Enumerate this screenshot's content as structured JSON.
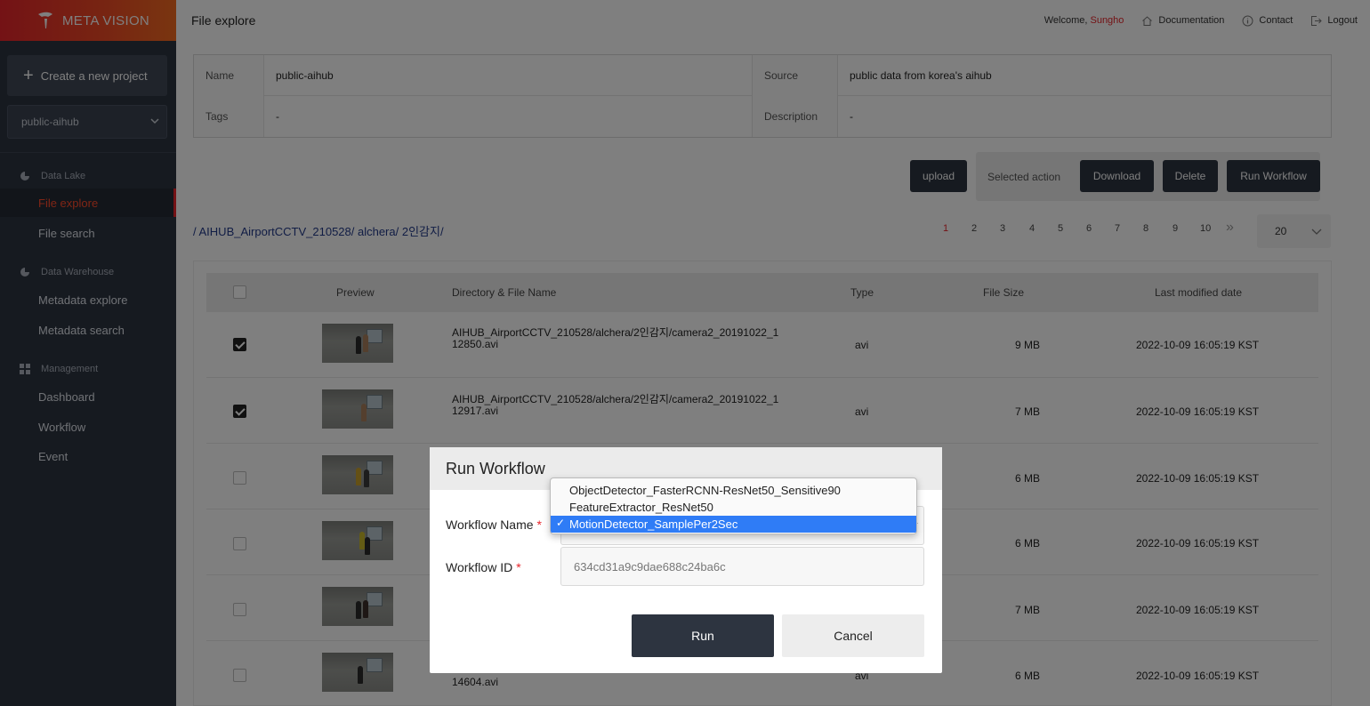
{
  "brand": {
    "name": "META VISION"
  },
  "sidebar": {
    "create_label": "Create a new project",
    "project": "public-aihub",
    "sections": [
      {
        "label": "Data Lake",
        "items": [
          "File explore",
          "File search"
        ]
      },
      {
        "label": "Data Warehouse",
        "items": [
          "Metadata explore",
          "Metadata search"
        ]
      },
      {
        "label": "Management",
        "items": [
          "Dashboard",
          "Workflow",
          "Event"
        ]
      }
    ],
    "active_item": "File explore"
  },
  "header": {
    "title": "File explore",
    "welcome": "Welcome,",
    "user": "Sungho",
    "links": [
      "Documentation",
      "Contact",
      "Logout"
    ]
  },
  "info": {
    "name_label": "Name",
    "name_value": "public-aihub",
    "source_label": "Source",
    "source_value": "public data from korea's aihub",
    "tags_label": "Tags",
    "tags_value": "-",
    "description_label": "Description",
    "description_value": "-"
  },
  "actions": {
    "upload": "upload",
    "selected_action": "Selected action",
    "download": "Download",
    "delete": "Delete",
    "run_workflow": "Run Workflow"
  },
  "path": "/ AIHUB_AirportCCTV_210528/ alchera/ 2인감지/",
  "pagination": {
    "pages": [
      "1",
      "2",
      "3",
      "4",
      "5",
      "6",
      "7",
      "8",
      "9",
      "10"
    ],
    "current": "1",
    "next": "»",
    "page_size": "20"
  },
  "table": {
    "headers": [
      "Preview",
      "Directory & File Name",
      "Type",
      "File Size",
      "Last modified date"
    ],
    "rows": [
      {
        "checked": true,
        "name_line1": "AIHUB_AirportCCTV_210528/alchera/2인감지/camera2_20191022_1",
        "name_line2": "12850.avi",
        "type": "avi",
        "size": "9 MB",
        "date": "2022-10-09 16:05:19 KST"
      },
      {
        "checked": true,
        "name_line1": "AIHUB_AirportCCTV_210528/alchera/2인감지/camera2_20191022_1",
        "name_line2": "12917.avi",
        "type": "avi",
        "size": "7 MB",
        "date": "2022-10-09 16:05:19 KST"
      },
      {
        "checked": false,
        "name_line1": "",
        "name_line2": "",
        "type": "",
        "size": "6 MB",
        "date": "2022-10-09 16:05:19 KST"
      },
      {
        "checked": false,
        "name_line1": "",
        "name_line2": "",
        "type": "",
        "size": "6 MB",
        "date": "2022-10-09 16:05:19 KST"
      },
      {
        "checked": false,
        "name_line1": "",
        "name_line2": "",
        "type": "",
        "size": "7 MB",
        "date": "2022-10-09 16:05:19 KST"
      },
      {
        "checked": false,
        "name_line1": "",
        "name_line2": "14604.avi",
        "type": "avi",
        "size": "6 MB",
        "date": "2022-10-09 16:05:19 KST"
      }
    ]
  },
  "modal": {
    "title": "Run Workflow",
    "workflow_name_label": "Workflow Name",
    "workflow_id_label": "Workflow ID",
    "required_mark": "*",
    "workflow_id_value": "634cd31a9c9dae688c24ba6c",
    "run": "Run",
    "cancel": "Cancel",
    "options": [
      "ObjectDetector_FasterRCNN-ResNet50_Sensitive90",
      "FeatureExtractor_ResNet50",
      "MotionDetector_SamplePer2Sec"
    ],
    "selected_option": "MotionDetector_SamplePer2Sec",
    "selected_mark": "✓"
  },
  "colors": {
    "accent": "#e8252b",
    "sidebar": "#2d3440",
    "selection": "#2f7cf6"
  }
}
